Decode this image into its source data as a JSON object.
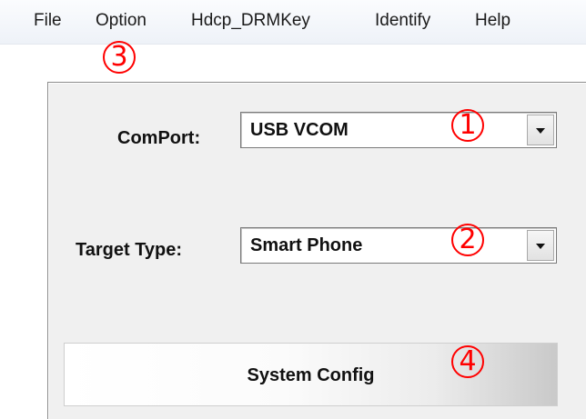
{
  "menubar": {
    "items": [
      {
        "label": "File"
      },
      {
        "label": "Option"
      },
      {
        "label": "Hdcp_DRMKey"
      },
      {
        "label": "Identify"
      },
      {
        "label": "Help"
      }
    ]
  },
  "form": {
    "comport": {
      "label": "ComPort:",
      "value": "USB VCOM"
    },
    "target_type": {
      "label": "Target Type:",
      "value": "Smart Phone"
    },
    "system_config_button": "System Config"
  },
  "annotations": {
    "markers": [
      "3",
      "1",
      "2",
      "4"
    ],
    "color": "#ff0000"
  }
}
